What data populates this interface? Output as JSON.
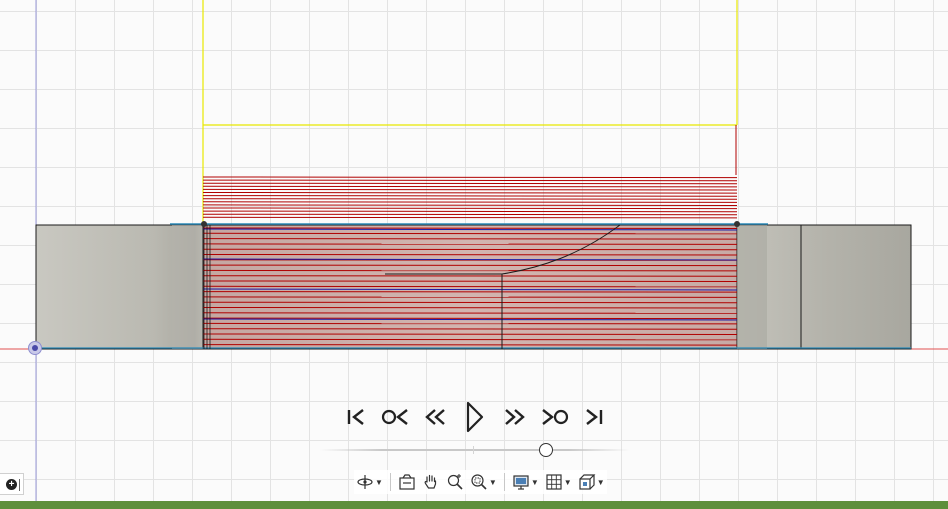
{
  "viewport": {
    "grid_color": "#e3e3e3",
    "background_color": "#fbfbfb"
  },
  "scene": {
    "stock_color": "#bdbcb4",
    "stock_outline_color": "#1a1a1a",
    "stock_box_color": "#e8e800",
    "toolpath_cut_color": "#b00000",
    "toolpath_link_color": "#1a1aa8",
    "axis_x_color": "#e05050",
    "axis_y_color": "#9a9ad8",
    "face_edge_color": "#2c8ab8"
  },
  "playback": {
    "controls": [
      {
        "icon": "skip-to-start-icon",
        "name": "skip-to-start-button"
      },
      {
        "icon": "previous-operation-icon",
        "name": "previous-operation-button"
      },
      {
        "icon": "step-back-icon",
        "name": "step-back-button"
      },
      {
        "icon": "play-icon",
        "name": "play-button"
      },
      {
        "icon": "step-forward-icon",
        "name": "step-forward-button"
      },
      {
        "icon": "next-operation-icon",
        "name": "next-operation-button"
      },
      {
        "icon": "skip-to-end-icon",
        "name": "skip-to-end-button"
      }
    ],
    "timeline_position": 0.73
  },
  "nav_toolbar": {
    "buttons": [
      {
        "icon": "orbit-icon",
        "dropdown": true
      },
      {
        "icon": "look-at-icon",
        "dropdown": false
      },
      {
        "icon": "pan-hand-icon",
        "dropdown": false
      },
      {
        "icon": "zoom-icon",
        "dropdown": false
      },
      {
        "icon": "fit-view-icon",
        "dropdown": true
      },
      {
        "icon": "display-settings-icon",
        "dropdown": true
      },
      {
        "icon": "grid-snaps-icon",
        "dropdown": true
      },
      {
        "icon": "viewports-icon",
        "dropdown": true
      }
    ]
  },
  "status_strip_color": "#5e8f3c"
}
